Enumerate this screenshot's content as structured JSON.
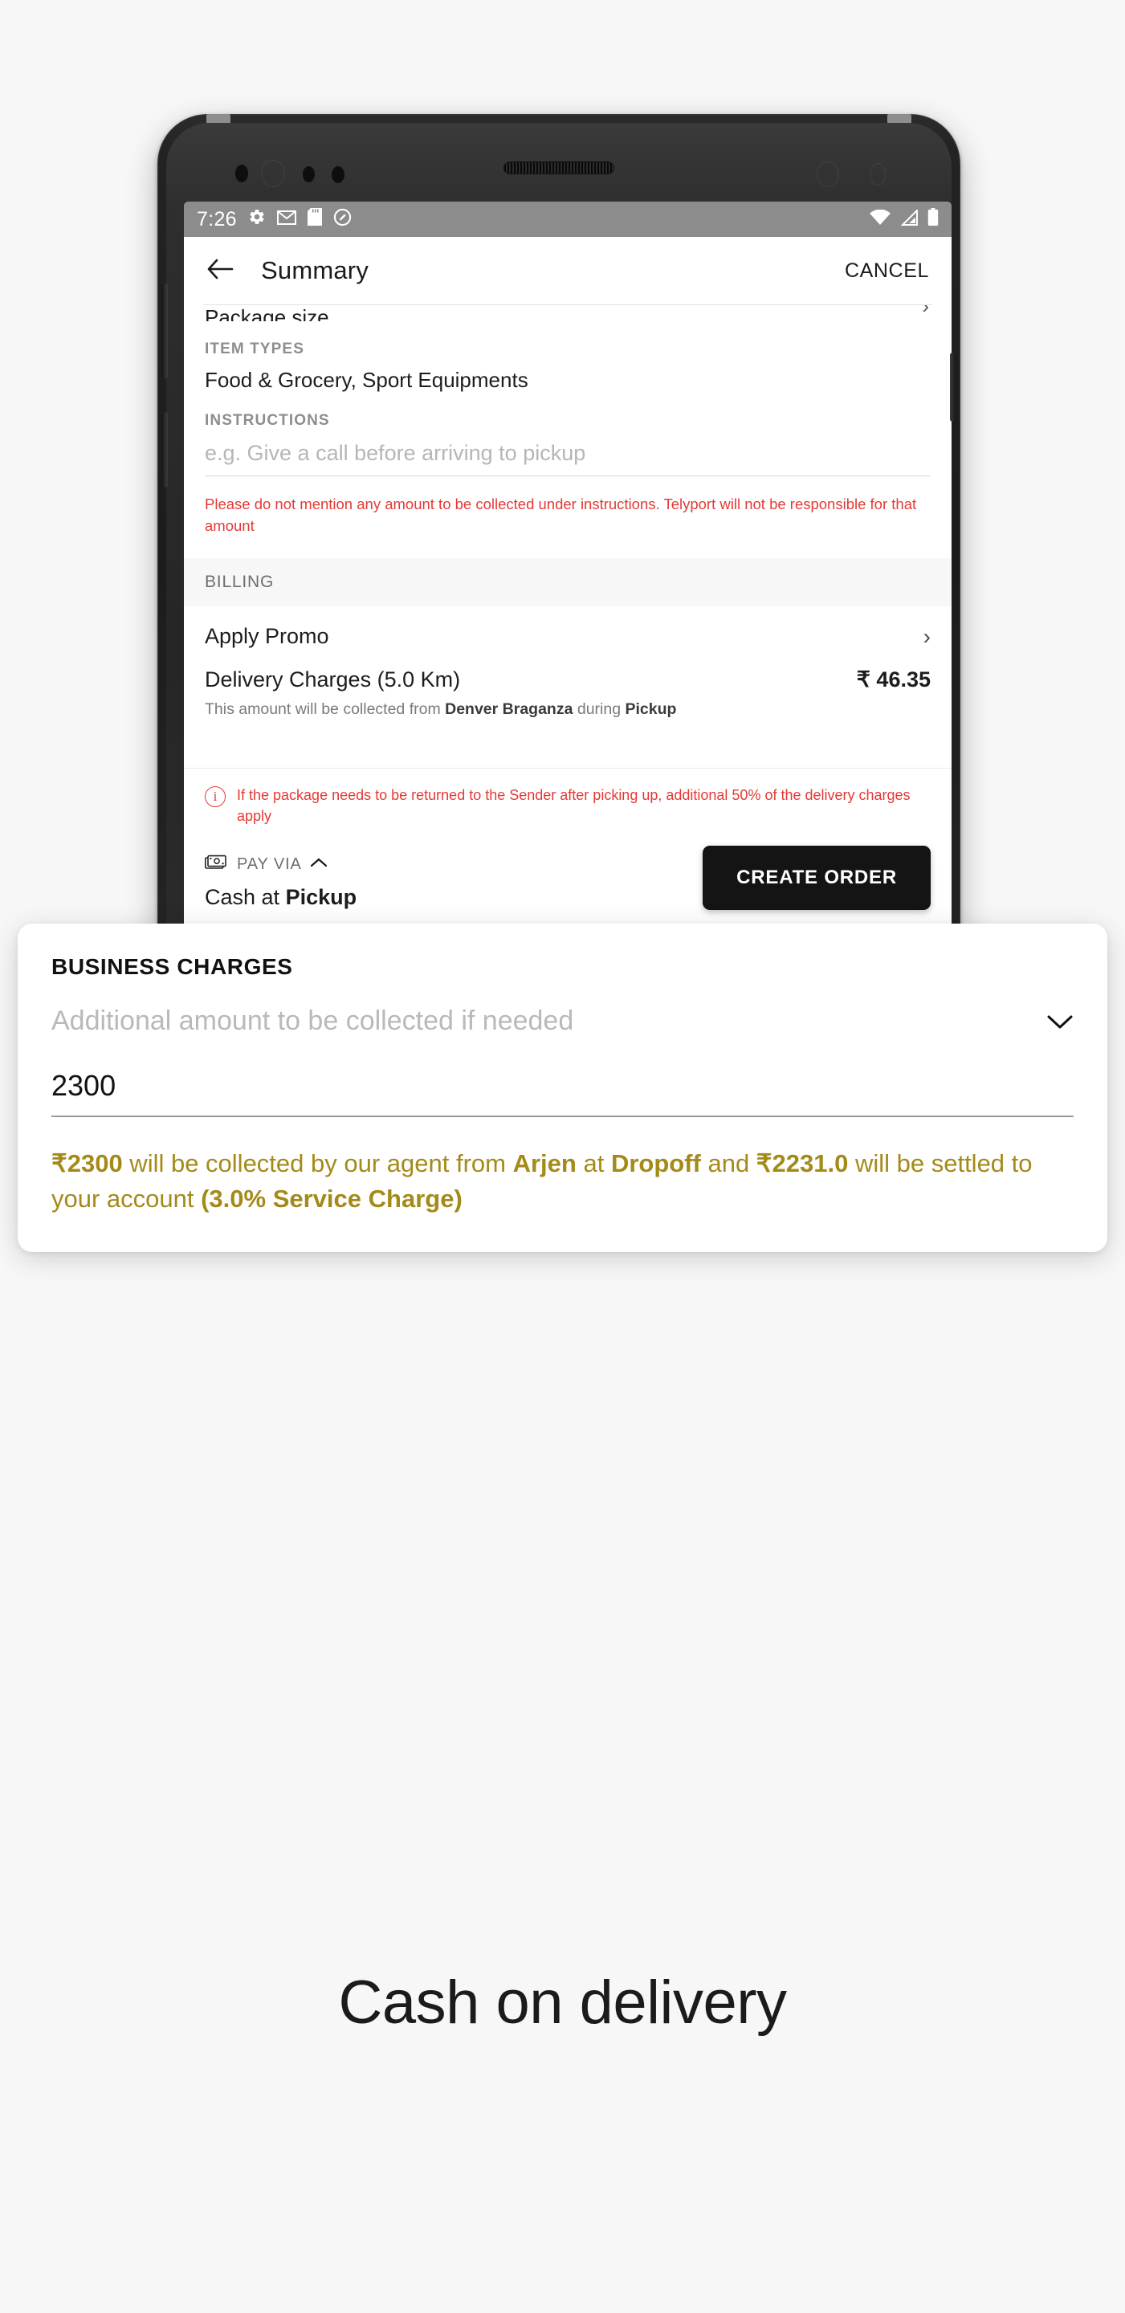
{
  "status_bar": {
    "time": "7:26",
    "left_icons": [
      "gear-icon",
      "gmail-icon",
      "sd-card-icon",
      "android-q-icon"
    ],
    "right_icons": [
      "wifi-icon",
      "signal-icon",
      "battery-icon"
    ]
  },
  "app_bar": {
    "back_icon": "back-arrow-icon",
    "title": "Summary",
    "action": "CANCEL"
  },
  "summary": {
    "item_types_label": "ITEM TYPES",
    "item_types_value": "Food & Grocery, Sport Equipments",
    "instructions_label": "INSTRUCTIONS",
    "instructions_placeholder": "e.g. Give a call before arriving to pickup",
    "instructions_value": "",
    "warning": "Please do not mention any amount to be collected under instructions. Telyport will not be responsible for that amount"
  },
  "billing": {
    "header": "BILLING",
    "promo_label": "Apply Promo",
    "promo_chevron": "chevron-right-icon",
    "delivery_label": "Delivery Charges (5.0 Km)",
    "delivery_amount": "₹ 46.35",
    "collected_note_prefix": "This amount will be collected from ",
    "collected_from": "Denver Braganza",
    "collected_note_mid": " during ",
    "collected_when": "Pickup"
  },
  "overlay": {
    "title": "BUSINESS CHARGES",
    "select_placeholder": "Additional amount to be collected if needed",
    "select_chevron": "chevron-down-icon",
    "amount_value": "2300",
    "note_parts": {
      "amount": "₹2300",
      "t1": " will be collected by our agent from ",
      "person": "Arjen",
      "t2": " at ",
      "stage": "Dropoff",
      "t3": " and ",
      "settled": "₹2231.0",
      "t4": " will be settled to your account ",
      "service": "(3.0% Service Charge)"
    },
    "note_color": "#a48a18"
  },
  "footer": {
    "info_icon": "info-icon",
    "info_text": "If the package needs to be returned to the Sender after picking up, additional 50% of the delivery charges apply",
    "pay_icon": "cash-icon",
    "pay_via_label": "PAY VIA",
    "pay_collapse_icon": "chevron-up-icon",
    "pay_method_prefix": "Cash at ",
    "pay_method_bold": "Pickup",
    "create_order": "CREATE ORDER"
  },
  "nav_bar": {
    "back": "back-triangle-icon",
    "home": "home-circle-icon",
    "recents": "recents-square-icon"
  },
  "caption": "Cash on delivery",
  "colors": {
    "page_bg": "#f7f7f7",
    "accent_gold": "#a48a18",
    "warning_red": "#e53935",
    "button_black": "#141414",
    "status_bar": "#8c8c8c"
  }
}
